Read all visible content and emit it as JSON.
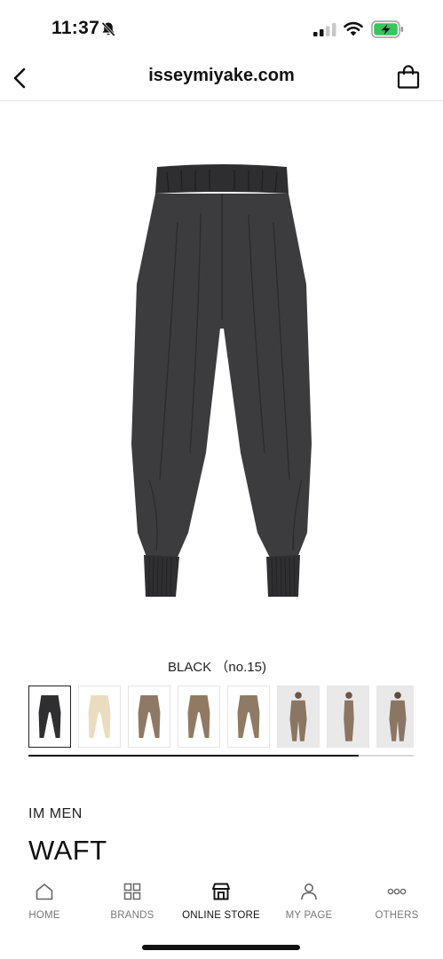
{
  "status_bar": {
    "time": "11:37",
    "icons": [
      "bell-slash-icon",
      "cellular-signal-icon",
      "wifi-icon",
      "battery-charging-icon"
    ],
    "battery_color": "#35c759"
  },
  "nav": {
    "title": "isseymiyake.com",
    "back_icon": "chevron-left-icon",
    "bag_icon": "shopping-bag-icon"
  },
  "product": {
    "color_label": "BLACK （no.15)",
    "brand": "IM MEN",
    "name": "WAFT",
    "main_color": "#3c3c3e",
    "thumbnails": [
      {
        "kind": "pants",
        "color": "#2f2f31",
        "selected": true
      },
      {
        "kind": "pants",
        "color": "#ecdcbf",
        "selected": false
      },
      {
        "kind": "pants",
        "color": "#8e7a64",
        "selected": false
      },
      {
        "kind": "pants",
        "color": "#907a62",
        "selected": false
      },
      {
        "kind": "pants",
        "color": "#8f7a66",
        "selected": false
      },
      {
        "kind": "model-front",
        "color": "#8a7663",
        "selected": false
      },
      {
        "kind": "model-side",
        "color": "#8a7663",
        "selected": false
      },
      {
        "kind": "model-back",
        "color": "#8a7663",
        "selected": false
      }
    ]
  },
  "tab_bar": {
    "tabs": [
      {
        "label": "HOME",
        "icon": "house-icon"
      },
      {
        "label": "BRANDS",
        "icon": "grid-icon"
      },
      {
        "label": "ONLINE STORE",
        "icon": "storefront-icon",
        "active": true
      },
      {
        "label": "MY PAGE",
        "icon": "person-icon"
      },
      {
        "label": "OTHERS",
        "icon": "ellipsis-circles-icon"
      }
    ]
  }
}
